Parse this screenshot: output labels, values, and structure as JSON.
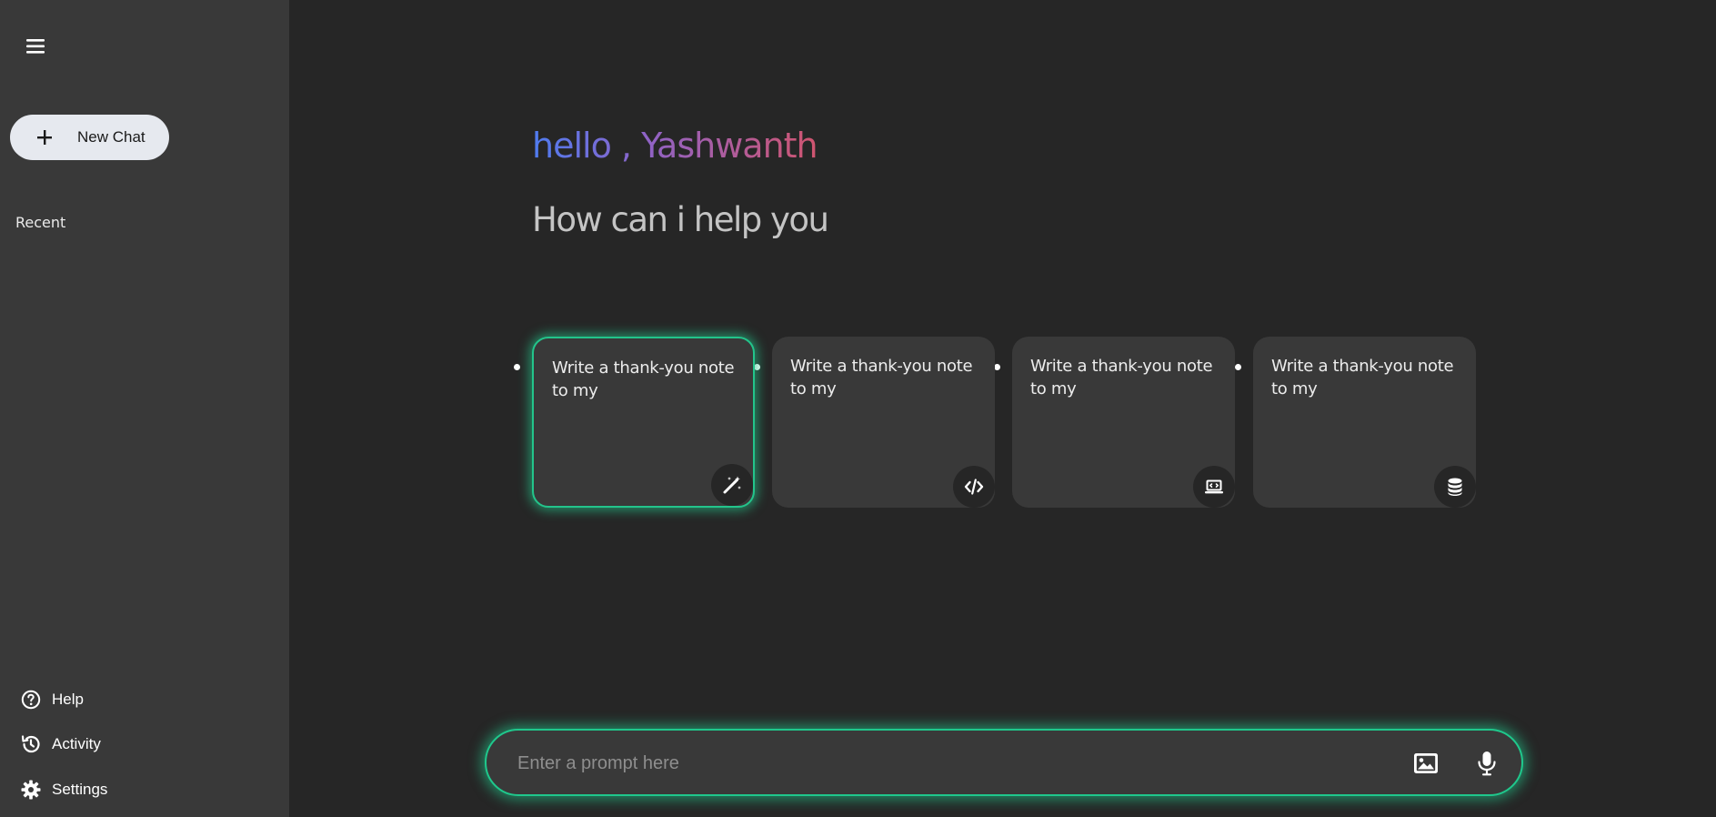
{
  "sidebar": {
    "menu_icon": "hamburger-icon",
    "new_chat_label": "New Chat",
    "new_chat_icon": "plus-icon",
    "recent_title": "Recent",
    "bottom_items": [
      {
        "label": "Help",
        "icon": "help-circle-icon"
      },
      {
        "label": "Activity",
        "icon": "history-icon"
      },
      {
        "label": "Settings",
        "icon": "gear-icon"
      }
    ]
  },
  "main": {
    "greeting": "hello , Yashwanth",
    "subheading": "How can i help you",
    "cards": [
      {
        "text": "Write a thank-you note to my",
        "icon": "magic-wand-icon",
        "active": true
      },
      {
        "text": "Write a thank-you note to my",
        "icon": "code-icon",
        "active": false
      },
      {
        "text": "Write a thank-you note to my",
        "icon": "laptop-code-icon",
        "active": false
      },
      {
        "text": "Write a thank-you note to my",
        "icon": "database-icon",
        "active": false
      }
    ]
  },
  "prompt": {
    "placeholder": "Enter a prompt here",
    "value": "",
    "image_icon": "image-icon",
    "mic_icon": "microphone-icon"
  },
  "colors": {
    "background": "#262626",
    "sidebar": "#393939",
    "card": "#393939",
    "accent_glow": "#23c48b",
    "gradient_start": "#4f7cf0",
    "gradient_end": "#d0556f",
    "subheading": "#c4c4c4"
  }
}
